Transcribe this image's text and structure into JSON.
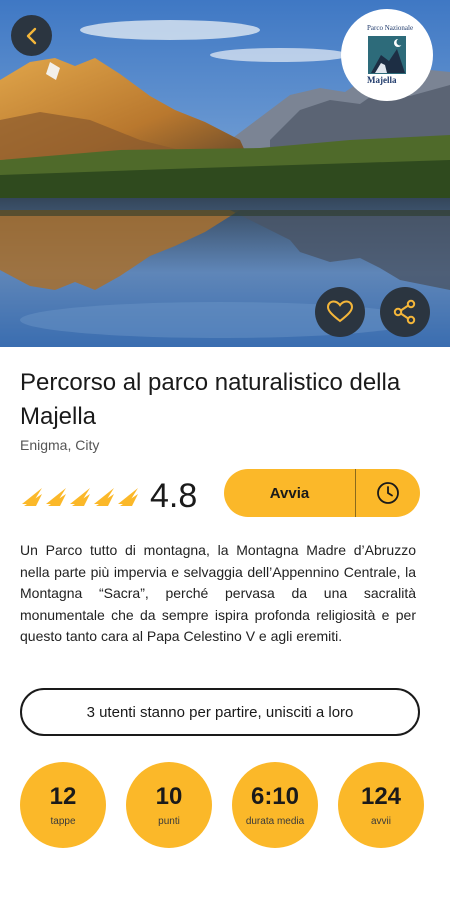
{
  "hero": {
    "image_icon": "mountain-lake-photo",
    "logo_top_text": "Parco Nazionale",
    "logo_bottom_text": "Majella"
  },
  "header": {
    "back_icon": "chevron-left-icon",
    "favorite_icon": "heart-icon",
    "share_icon": "share-icon"
  },
  "route": {
    "title": "Percorso al parco naturalistico della Majella",
    "subtitle": "Enigma, City",
    "rating": "4.8",
    "stars": 5,
    "description": "Un Parco tutto di montagna, la Montagna Madre d’Abruzzo nella parte più impervia e selvaggia dell’Appennino Centrale, la Montagna “Sacra”, perché pervasa da una sacralità monumentale che da sempre ispira profonda religiosità e per questo tanto cara al Papa Celestino V e agli eremiti."
  },
  "actions": {
    "start_label": "Avvia",
    "schedule_icon": "clock-icon",
    "join_label": "3 utenti stanno per partire, unisciti a loro"
  },
  "stats": [
    {
      "value": "12",
      "label": "tappe"
    },
    {
      "value": "10",
      "label": "punti"
    },
    {
      "value": "6:10",
      "label": "durata media"
    },
    {
      "value": "124",
      "label": "avvii"
    }
  ],
  "colors": {
    "accent": "#fbb829",
    "dark_button": "#2b3540",
    "star": "#fbb829"
  }
}
